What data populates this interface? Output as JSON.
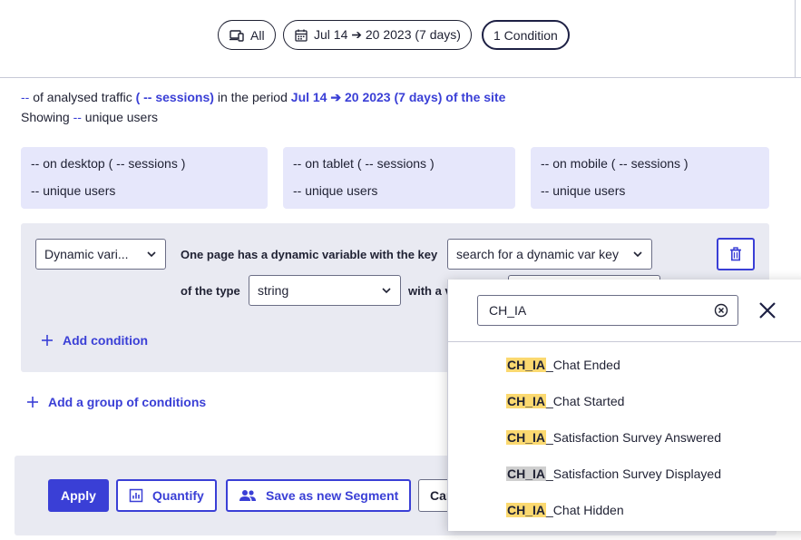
{
  "toolbar": {
    "device_label": "All",
    "period_label": "Jul 14 ➔ 20 2023 (7 days)",
    "condition_label": "1 Condition"
  },
  "summary": {
    "line1_lead": "--",
    "line1_text1": " of analysed traffic ",
    "line1_sessions": "( -- sessions)",
    "line1_text2": " in the period ",
    "line1_period": "Jul 14 ➔ 20 2023 (7 days) of the site",
    "line2_text": "Showing ",
    "line2_users": "--",
    "line2_suffix": " unique users"
  },
  "devices": [
    {
      "sessions": "-- on desktop ( -- sessions )",
      "users": "-- unique users"
    },
    {
      "sessions": "-- on tablet ( -- sessions )",
      "users": "-- unique users"
    },
    {
      "sessions": "-- on mobile ( -- sessions )",
      "users": "-- unique users"
    }
  ],
  "condition": {
    "type_select": "Dynamic vari...",
    "key_label": "One page has a dynamic variable with the key",
    "key_select": "search for a dynamic var key",
    "of_type_label": "of the type",
    "type_value": "string",
    "with_value_label": "with a v",
    "add_condition": "Add condition"
  },
  "add_group": "Add a group of conditions",
  "actions": {
    "apply": "Apply",
    "quantify": "Quantify",
    "save_segment": "Save as new Segment",
    "cancel": "Car"
  },
  "dropdown": {
    "search_value": "CH_IA",
    "options": [
      {
        "match": "CH_IA",
        "rest": "_Chat Ended"
      },
      {
        "match": "CH_IA",
        "rest": "_Chat Started"
      },
      {
        "match": "CH_IA",
        "rest": "_Satisfaction Survey Answered"
      },
      {
        "match": "CH_IA",
        "rest": "_Satisfaction Survey Displayed"
      },
      {
        "match": "CH_IA",
        "rest": "_Chat Hidden"
      }
    ]
  },
  "colors": {
    "accent": "#3a3fd6",
    "highlight": "#fbd970",
    "panel": "#e9eaf2",
    "device_box": "#e6e7fb"
  }
}
